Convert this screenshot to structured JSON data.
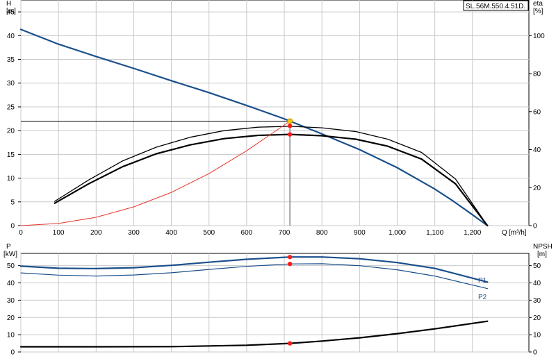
{
  "model": "SL.56M.550.4.51D.",
  "chart_data": [
    {
      "type": "line",
      "y_title": "H",
      "y_unit": "[m]",
      "y2_title": "eta",
      "y2_unit": "[%]",
      "x_title": "Q",
      "x_unit": "[m³/h]",
      "xlim": [
        0,
        1350
      ],
      "ylim": [
        0,
        47.5
      ],
      "y2lim": [
        0,
        118.75
      ],
      "x_ticks": [
        0,
        100,
        200,
        300,
        400,
        500,
        600,
        700,
        800,
        900,
        1000,
        1100,
        1200
      ],
      "x_tick_labels": [
        "0",
        "100",
        "200",
        "300",
        "400",
        "500",
        "600",
        "700",
        "800",
        "900",
        "1,000",
        "1,100",
        "1,200"
      ],
      "y_ticks": [
        0,
        5,
        10,
        15,
        20,
        25,
        30,
        35,
        40,
        45
      ],
      "y2_ticks": [
        0,
        20,
        40,
        60,
        80,
        100
      ],
      "grid": true,
      "series": [
        {
          "key": "head",
          "axis": "left",
          "color": "#1a4f8b",
          "width": 2.2,
          "x": [
            0,
            100,
            200,
            300,
            400,
            500,
            600,
            700,
            800,
            900,
            1000,
            1100,
            1150,
            1200,
            1240
          ],
          "y": [
            41.3,
            38.2,
            35.6,
            33.1,
            30.5,
            28.0,
            25.3,
            22.5,
            19.3,
            16.0,
            12.2,
            7.7,
            5.1,
            2.3,
            0
          ]
        },
        {
          "key": "eta_thin",
          "axis": "right",
          "color": "#000000",
          "width": 1.3,
          "x": [
            90,
            180,
            270,
            360,
            450,
            540,
            630,
            715,
            800,
            890,
            975,
            1065,
            1155,
            1240
          ],
          "y": [
            12.8,
            24.0,
            34.0,
            41.3,
            46.5,
            50.0,
            51.8,
            52.3,
            51.5,
            49.5,
            45.5,
            38.5,
            24.5,
            0
          ]
        },
        {
          "key": "eta_thick",
          "axis": "right",
          "color": "#000000",
          "width": 2.2,
          "x": [
            90,
            180,
            270,
            360,
            450,
            540,
            630,
            715,
            800,
            890,
            975,
            1065,
            1155,
            1240
          ],
          "y": [
            11.8,
            22.0,
            31.0,
            37.8,
            42.5,
            45.8,
            47.5,
            48.0,
            47.3,
            45.5,
            41.8,
            35.0,
            22.0,
            0
          ]
        },
        {
          "key": "system",
          "axis": "left",
          "color": "#e8362a",
          "width": 1.0,
          "x": [
            0,
            100,
            200,
            300,
            400,
            500,
            600,
            715
          ],
          "y": [
            0,
            0.45,
            1.75,
            3.95,
            7.0,
            10.95,
            15.75,
            22.0
          ]
        }
      ],
      "duty_h": 22.0,
      "duty_q": 715,
      "duty_points": [
        {
          "axis": "left",
          "x": 715,
          "y": 22.0,
          "color": "#f7c600"
        },
        {
          "axis": "left",
          "x": 715,
          "y": 21.0,
          "color": "#ff1a1a"
        },
        {
          "axis": "left",
          "x": 715,
          "y": 19.2,
          "color": "#ff1a1a"
        }
      ]
    },
    {
      "type": "line",
      "y_title": "P",
      "y_unit": "[kW]",
      "y2_title": "NPSH",
      "y2_unit": "[m]",
      "xlim": [
        0,
        1350
      ],
      "ylim": [
        0,
        57.1
      ],
      "y2lim": [
        0,
        57.1
      ],
      "y_ticks": [
        0,
        10,
        20,
        30,
        40,
        50
      ],
      "y2_ticks": [
        0,
        10,
        20,
        30,
        40,
        50
      ],
      "grid": true,
      "series": [
        {
          "key": "p1",
          "name": "P1",
          "axis": "left",
          "color": "#1a4f8b",
          "width": 2.2,
          "x": [
            0,
            100,
            200,
            300,
            400,
            500,
            600,
            715,
            800,
            900,
            1000,
            1100,
            1240
          ],
          "y": [
            49.7,
            48.5,
            48.3,
            48.8,
            50.2,
            52.0,
            53.7,
            55.0,
            55.0,
            54.0,
            51.8,
            48.4,
            40.5
          ]
        },
        {
          "key": "p2",
          "name": "P2",
          "axis": "left",
          "color": "#1a4f8b",
          "width": 1.2,
          "x": [
            0,
            100,
            200,
            300,
            400,
            500,
            600,
            715,
            800,
            900,
            1000,
            1100,
            1240
          ],
          "y": [
            45.8,
            44.5,
            44.0,
            44.6,
            45.9,
            47.8,
            49.6,
            51.0,
            51.1,
            50.0,
            47.6,
            44.0,
            36.7
          ]
        },
        {
          "key": "npsh",
          "axis": "right",
          "color": "#000000",
          "width": 2.2,
          "x": [
            0,
            200,
            400,
            600,
            715,
            800,
            900,
            1000,
            1100,
            1240
          ],
          "y": [
            3.0,
            3.0,
            3.1,
            3.9,
            5.0,
            6.3,
            8.2,
            10.6,
            13.4,
            17.8
          ]
        }
      ],
      "duty_q": 715,
      "duty_points": [
        {
          "axis": "left",
          "x": 715,
          "y": 55.0,
          "color": "#ff1a1a"
        },
        {
          "axis": "left",
          "x": 715,
          "y": 51.0,
          "color": "#ff1a1a"
        },
        {
          "axis": "right",
          "x": 715,
          "y": 5.0,
          "color": "#ff1a1a"
        }
      ]
    }
  ]
}
